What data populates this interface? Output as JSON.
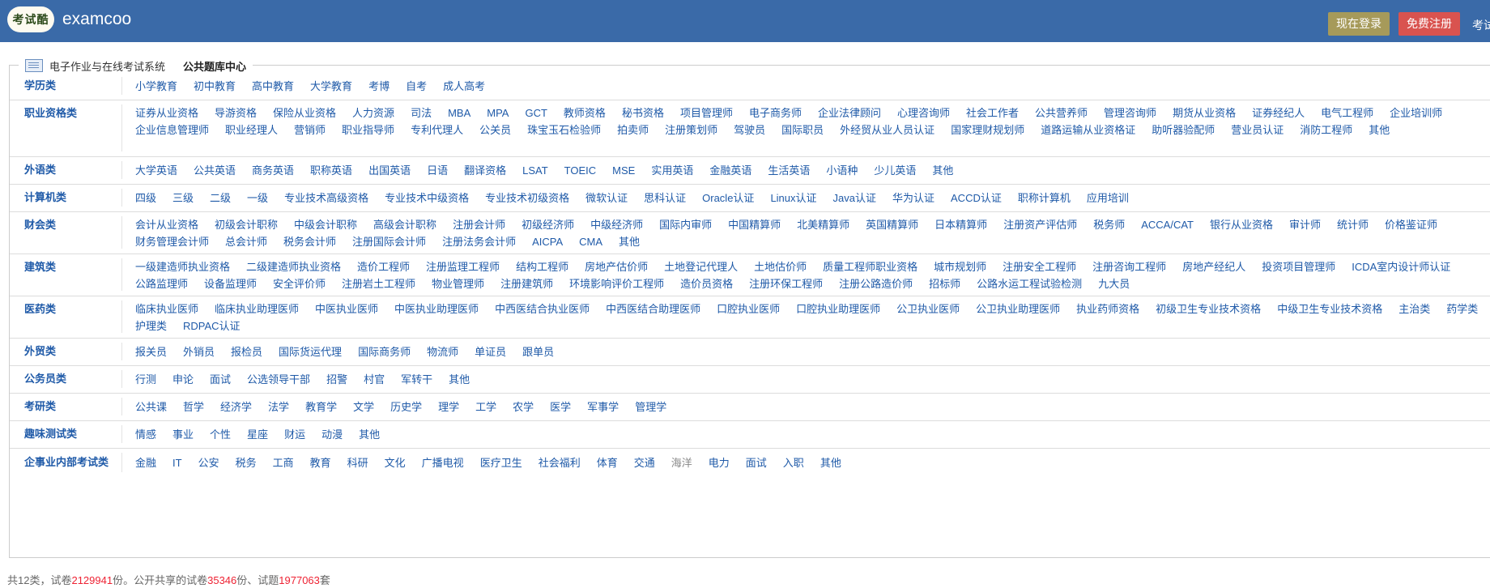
{
  "header": {
    "logo_text": "考试酷",
    "brand": "examcoo",
    "login_label": "现在登录",
    "register_label": "免费注册",
    "extra_label": "考试"
  },
  "panel": {
    "system_title": "电子作业与在线考试系统",
    "center_title": "公共题库中心"
  },
  "categories": [
    {
      "name": "学历类",
      "items": [
        "小学教育",
        "初中教育",
        "高中教育",
        "大学教育",
        "考博",
        "自考",
        "成人高考"
      ]
    },
    {
      "name": "职业资格类",
      "items": [
        "证券从业资格",
        "导游资格",
        "保险从业资格",
        "人力资源",
        "司法",
        "MBA",
        "MPA",
        "GCT",
        "教师资格",
        "秘书资格",
        "项目管理师",
        "电子商务师",
        "企业法律顾问",
        "心理咨询师",
        "社会工作者",
        "公共营养师",
        "管理咨询师",
        "期货从业资格",
        "证券经纪人",
        "电气工程师",
        "企业培训师",
        "企业信息管理师",
        "职业经理人",
        "营销师",
        "职业指导师",
        "专利代理人",
        "公关员",
        "珠宝玉石检验师",
        "拍卖师",
        "注册策划师",
        "驾驶员",
        "国际职员",
        "外经贸从业人员认证",
        "国家理财规划师",
        "道路运输从业资格证",
        "助听器验配师",
        "营业员认证",
        "消防工程师",
        "其他"
      ]
    },
    {
      "name": "外语类",
      "items": [
        "大学英语",
        "公共英语",
        "商务英语",
        "职称英语",
        "出国英语",
        "日语",
        "翻译资格",
        "LSAT",
        "TOEIC",
        "MSE",
        "实用英语",
        "金融英语",
        "生活英语",
        "小语种",
        "少儿英语",
        "其他"
      ]
    },
    {
      "name": "计算机类",
      "items": [
        "四级",
        "三级",
        "二级",
        "一级",
        "专业技术高级资格",
        "专业技术中级资格",
        "专业技术初级资格",
        "微软认证",
        "思科认证",
        "Oracle认证",
        "Linux认证",
        "Java认证",
        "华为认证",
        "ACCD认证",
        "职称计算机",
        "应用培训"
      ]
    },
    {
      "name": "财会类",
      "items": [
        "会计从业资格",
        "初级会计职称",
        "中级会计职称",
        "高级会计职称",
        "注册会计师",
        "初级经济师",
        "中级经济师",
        "国际内审师",
        "中国精算师",
        "北美精算师",
        "英国精算师",
        "日本精算师",
        "注册资产评估师",
        "税务师",
        "ACCA/CAT",
        "银行从业资格",
        "审计师",
        "统计师",
        "价格鉴证师",
        "财务管理会计师",
        "总会计师",
        "税务会计师",
        "注册国际会计师",
        "注册法务会计师",
        "AICPA",
        "CMA",
        "其他"
      ]
    },
    {
      "name": "建筑类",
      "items": [
        "一级建造师执业资格",
        "二级建造师执业资格",
        "造价工程师",
        "注册监理工程师",
        "结构工程师",
        "房地产估价师",
        "土地登记代理人",
        "土地估价师",
        "质量工程师职业资格",
        "城市规划师",
        "注册安全工程师",
        "注册咨询工程师",
        "房地产经纪人",
        "投资项目管理师",
        "ICDA室内设计师认证",
        "公路监理师",
        "设备监理师",
        "安全评价师",
        "注册岩土工程师",
        "物业管理师",
        "注册建筑师",
        "环境影响评价工程师",
        "造价员资格",
        "注册环保工程师",
        "注册公路造价师",
        "招标师",
        "公路水运工程试验检测",
        "九大员"
      ]
    },
    {
      "name": "医药类",
      "items": [
        "临床执业医师",
        "临床执业助理医师",
        "中医执业医师",
        "中医执业助理医师",
        "中西医结合执业医师",
        "中西医结合助理医师",
        "口腔执业医师",
        "口腔执业助理医师",
        "公卫执业医师",
        "公卫执业助理医师",
        "执业药师资格",
        "初级卫生专业技术资格",
        "中级卫生专业技术资格",
        "主治类",
        "药学类",
        "护理类",
        "RDPAC认证"
      ]
    },
    {
      "name": "外贸类",
      "items": [
        "报关员",
        "外销员",
        "报检员",
        "国际货运代理",
        "国际商务师",
        "物流师",
        "单证员",
        "跟单员"
      ]
    },
    {
      "name": "公务员类",
      "items": [
        "行测",
        "申论",
        "面试",
        "公选领导干部",
        "招警",
        "村官",
        "军转干",
        "其他"
      ]
    },
    {
      "name": "考研类",
      "items": [
        "公共课",
        "哲学",
        "经济学",
        "法学",
        "教育学",
        "文学",
        "历史学",
        "理学",
        "工学",
        "农学",
        "医学",
        "军事学",
        "管理学"
      ]
    },
    {
      "name": "趣味测试类",
      "items": [
        "情感",
        "事业",
        "个性",
        "星座",
        "财运",
        "动漫",
        "其他"
      ]
    },
    {
      "name": "企事业内部考试类",
      "items": [
        "金融",
        "IT",
        "公安",
        "税务",
        "工商",
        "教育",
        "科研",
        "文化",
        "广播电视",
        "医疗卫生",
        "社会福利",
        "体育",
        "交通",
        "海洋",
        "电力",
        "面试",
        "入职",
        "其他"
      ]
    }
  ],
  "footer": {
    "p1": "共12类，试卷",
    "papers": "2129941",
    "p2": "份。公开共享的试卷",
    "shared_papers": "35346",
    "p3": "份、试题",
    "questions": "1977063",
    "p4": "套"
  },
  "colors": {
    "header_bg": "#3a6aa8",
    "login_btn": "#a69a5a",
    "register_btn": "#d9534f",
    "link": "#1f5aa8",
    "footer_number": "#e23"
  }
}
